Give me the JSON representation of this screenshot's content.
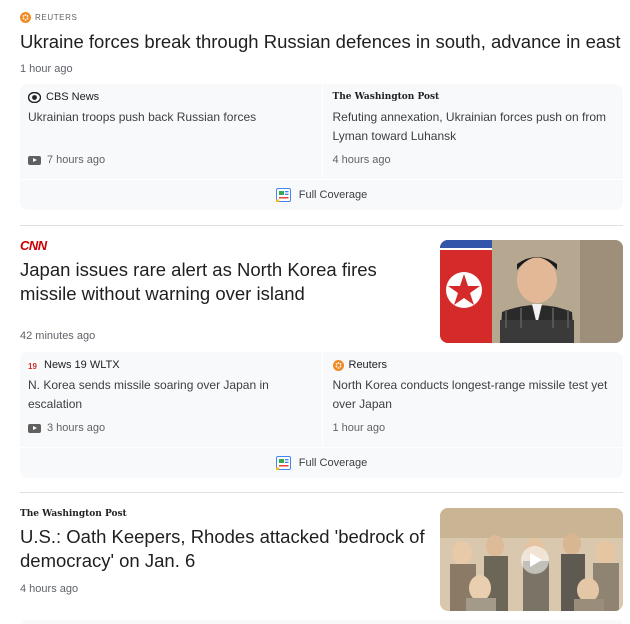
{
  "stories": [
    {
      "source": "REUTERS",
      "headline": "Ukraine forces break through Russian defences in south, advance in east",
      "time": "1 hour ago",
      "related": [
        {
          "source": "CBS News",
          "title": "Ukrainian troops push back Russian forces",
          "time": "7 hours ago",
          "icon": "video-icon"
        },
        {
          "source": "The Washington Post",
          "title": "Refuting annexation, Ukrainian forces push on from Lyman toward Luhansk",
          "time": "4 hours ago"
        }
      ],
      "full_coverage": "Full Coverage"
    },
    {
      "source": "CNN",
      "headline": "Japan issues rare alert as North Korea fires missile without warning over island",
      "time": "42 minutes ago",
      "related": [
        {
          "source": "News 19 WLTX",
          "title": "N. Korea sends missile soaring over Japan in escalation",
          "time": "3 hours ago",
          "icon": "video-icon"
        },
        {
          "source": "Reuters",
          "title": "North Korea conducts longest-range missile test yet over Japan",
          "time": "1 hour ago"
        }
      ],
      "full_coverage": "Full Coverage"
    },
    {
      "source": "The Washington Post",
      "headline": "U.S.: Oath Keepers, Rhodes attacked 'bedrock of democracy' on Jan. 6",
      "time": "4 hours ago"
    }
  ],
  "colors": {
    "cnn_red": "#cc0000",
    "reuters_orange": "#f08a24",
    "card_bg": "#f8f9fa"
  }
}
